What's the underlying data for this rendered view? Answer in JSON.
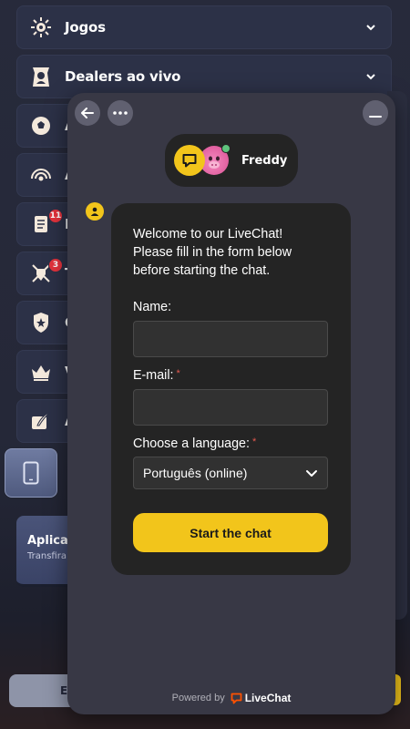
{
  "background": {
    "menu": [
      {
        "label": "Jogos",
        "icon": "jogos-icon",
        "has_chevron": true
      },
      {
        "label": "Dealers ao vivo",
        "icon": "dealer-icon",
        "has_chevron": true
      },
      {
        "initial": "A",
        "icon": "soccer-ball-icon"
      },
      {
        "initial": "A",
        "icon": "broadcast-icon"
      },
      {
        "initial": "P",
        "icon": "scroll-icon",
        "badge": "11"
      },
      {
        "initial": "T",
        "icon": "shield-swords-icon",
        "badge": "3"
      },
      {
        "initial": "C",
        "icon": "shield-star-icon"
      },
      {
        "initial": "V",
        "icon": "crown-icon"
      },
      {
        "initial": "A",
        "icon": "quill-icon"
      }
    ],
    "app_card": {
      "title": "Aplicaç",
      "subtitle": "Transfira"
    },
    "bottom_button": "E"
  },
  "chat": {
    "agent_name": "Freddy",
    "welcome_text": "Welcome to our LiveChat!\nPlease fill in the form below\nbefore starting the chat.",
    "name_label": "Name:",
    "name_value": "",
    "email_label": "E-mail:",
    "email_value": "",
    "required_mark": "*",
    "language_label": "Choose a language:",
    "language_selected": "Português (online)",
    "start_button": "Start the chat",
    "powered_by": "Powered by",
    "brand": "LiveChat"
  },
  "colors": {
    "accent_yellow": "#f2c51b",
    "widget_bg": "#383845",
    "card_bg": "#242424",
    "required_red": "#e5594f",
    "badge_red": "#e5333d"
  }
}
